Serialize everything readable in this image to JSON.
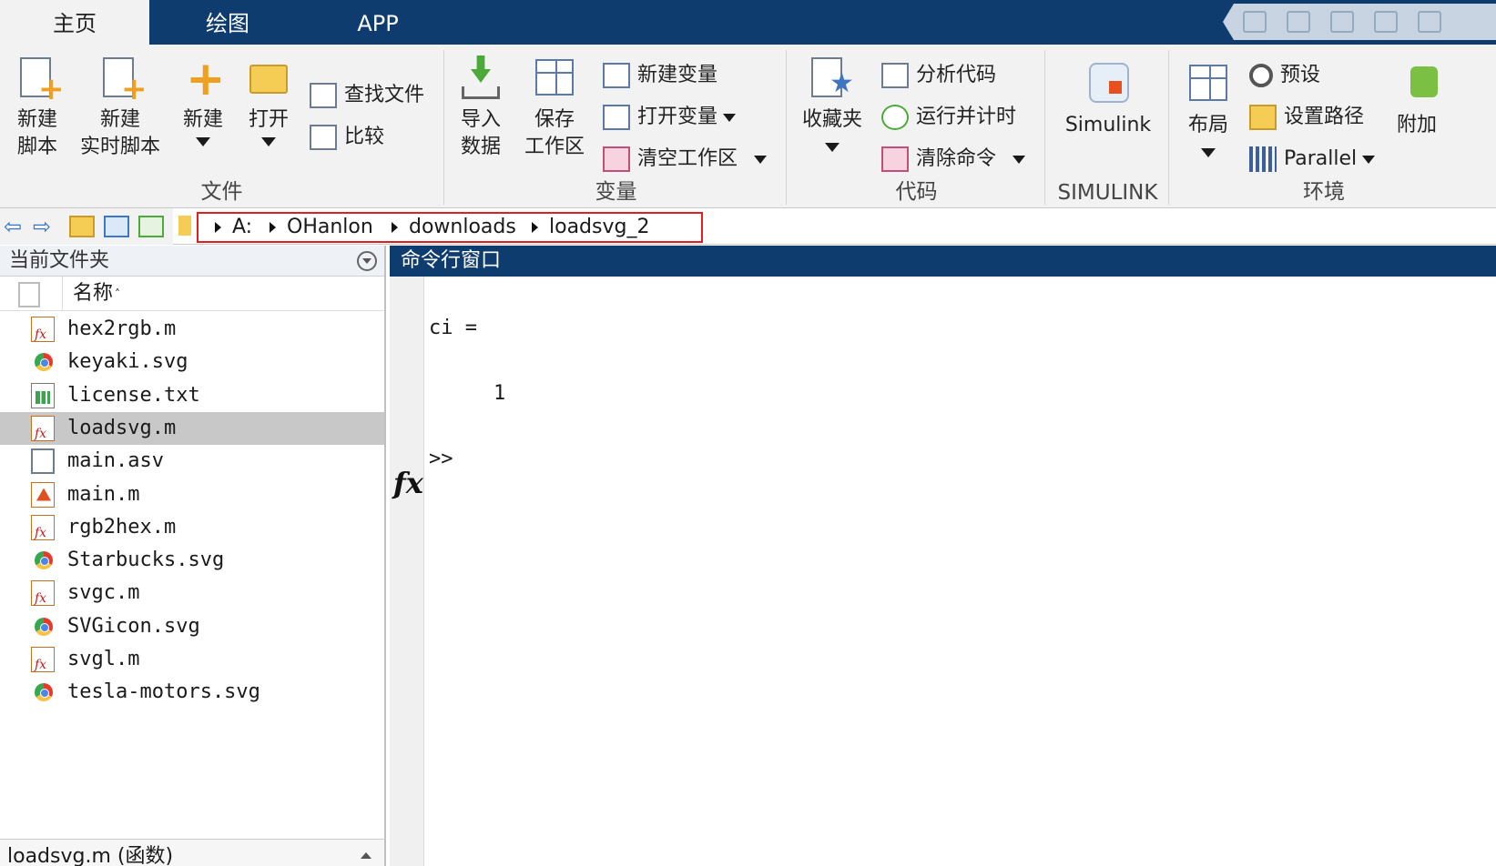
{
  "tabs": [
    "主页",
    "绘图",
    "APP"
  ],
  "ribbon": {
    "file": {
      "title": "文件",
      "new_script": [
        "新建",
        "脚本"
      ],
      "new_live_script": [
        "新建",
        "实时脚本"
      ],
      "new": "新建",
      "open": "打开",
      "find_files": "查找文件",
      "compare": "比较"
    },
    "variable": {
      "title": "变量",
      "import_data": [
        "导入",
        "数据"
      ],
      "save_workspace": [
        "保存",
        "工作区"
      ],
      "new_variable": "新建变量",
      "open_variable": "打开变量",
      "clear_workspace": "清空工作区"
    },
    "code": {
      "title": "代码",
      "favorites": "收藏夹",
      "analyze_code": "分析代码",
      "run_and_time": "运行并计时",
      "clear_commands": "清除命令"
    },
    "simulink": {
      "title": "SIMULINK",
      "simulink": "Simulink"
    },
    "environment": {
      "title": "环境",
      "layout": "布局",
      "preferences": "预设",
      "set_path": "设置路径",
      "parallel": "Parallel",
      "addons": "附加"
    }
  },
  "address": {
    "crumbs": [
      "A:",
      "OHanlon",
      "downloads",
      "loadsvg_2"
    ]
  },
  "current_folder": {
    "title": "当前文件夹",
    "column_name": "名称",
    "files": [
      {
        "name": "hex2rgb.m",
        "type": "m"
      },
      {
        "name": "keyaki.svg",
        "type": "svg"
      },
      {
        "name": "license.txt",
        "type": "txt"
      },
      {
        "name": "loadsvg.m",
        "type": "m"
      },
      {
        "name": "main.asv",
        "type": "blank"
      },
      {
        "name": "main.m",
        "type": "main"
      },
      {
        "name": "rgb2hex.m",
        "type": "m"
      },
      {
        "name": "Starbucks.svg",
        "type": "svg"
      },
      {
        "name": "svgc.m",
        "type": "m"
      },
      {
        "name": "SVGicon.svg",
        "type": "svg"
      },
      {
        "name": "svgl.m",
        "type": "m"
      },
      {
        "name": "tesla-motors.svg",
        "type": "svg"
      }
    ],
    "selected": "loadsvg.m",
    "details": "loadsvg.m  (函数)"
  },
  "command_window": {
    "title": "命令行窗口",
    "line1": "ci =",
    "line2": "1",
    "prompt": ">>",
    "fx": "fx"
  },
  "colors": {
    "tabbar": "#0f3c6e",
    "ribbon": "#f2f2f2",
    "highlight_box": "#e02020",
    "selected_row": "#c8c8c8"
  }
}
